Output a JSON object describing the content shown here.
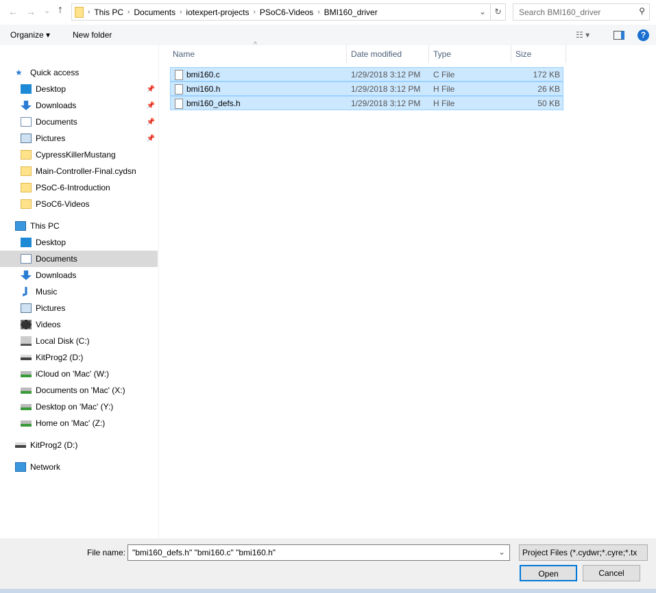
{
  "nav": {
    "back": "←",
    "forward": "→",
    "recent": "⌄",
    "up": "↑",
    "breadcrumbs": [
      "This PC",
      "Documents",
      "iotexpert-projects",
      "PSoC6-Videos",
      "BMI160_driver"
    ],
    "search_placeholder": "Search BMI160_driver"
  },
  "toolbar": {
    "organize": "Organize ▾",
    "new_folder": "New folder"
  },
  "sidebar": {
    "quick_access": "Quick access",
    "quick": [
      {
        "label": "Desktop",
        "pinned": true
      },
      {
        "label": "Downloads",
        "pinned": true
      },
      {
        "label": "Documents",
        "pinned": true
      },
      {
        "label": "Pictures",
        "pinned": true
      },
      {
        "label": "CypressKillerMustang"
      },
      {
        "label": "Main-Controller-Final.cydsn"
      },
      {
        "label": "PSoC-6-Introduction"
      },
      {
        "label": "PSoC6-Videos"
      }
    ],
    "this_pc": "This PC",
    "pc": [
      {
        "label": "Desktop"
      },
      {
        "label": "Documents"
      },
      {
        "label": "Downloads"
      },
      {
        "label": "Music"
      },
      {
        "label": "Pictures"
      },
      {
        "label": "Videos"
      },
      {
        "label": "Local Disk (C:)"
      },
      {
        "label": "KitProg2 (D:)"
      },
      {
        "label": "iCloud on 'Mac' (W:)"
      },
      {
        "label": "Documents on 'Mac' (X:)"
      },
      {
        "label": "Desktop on 'Mac' (Y:)"
      },
      {
        "label": "Home on 'Mac' (Z:)"
      }
    ],
    "kitprog": "KitProg2 (D:)",
    "network": "Network"
  },
  "columns": {
    "name": "Name",
    "date": "Date modified",
    "type": "Type",
    "size": "Size"
  },
  "files": [
    {
      "name": "bmi160.c",
      "date": "1/29/2018 3:12 PM",
      "type": "C File",
      "size": "172 KB"
    },
    {
      "name": "bmi160.h",
      "date": "1/29/2018 3:12 PM",
      "type": "H File",
      "size": "26 KB"
    },
    {
      "name": "bmi160_defs.h",
      "date": "1/29/2018 3:12 PM",
      "type": "H File",
      "size": "50 KB"
    }
  ],
  "footer": {
    "file_name_label": "File name:",
    "file_name_value": "\"bmi160_defs.h\" \"bmi160.c\" \"bmi160.h\"",
    "file_type": "Project Files (*.cydwr;*.cyre;*.tx",
    "open": "Open",
    "cancel": "Cancel"
  }
}
